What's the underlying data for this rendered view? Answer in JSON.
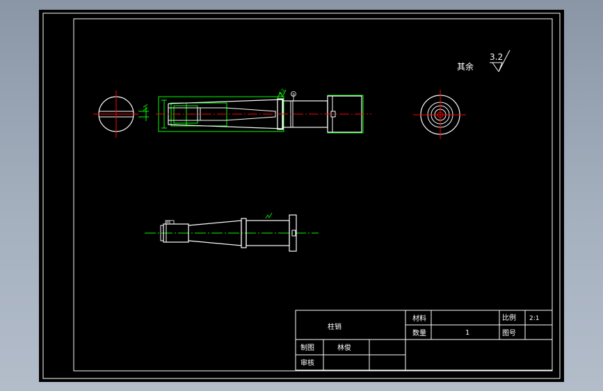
{
  "drawing": {
    "roughness_note": {
      "label": "其余",
      "value": "3.2"
    },
    "datum_marker": "③"
  },
  "title_block": {
    "part_name": "柱销",
    "material_label": "材料",
    "material_value": "",
    "quantity_label": "数量",
    "quantity_value": "1",
    "scale_label": "比例",
    "scale_value": "2:1",
    "drawing_no_label": "图号",
    "drawing_no_value": "",
    "drawn_by_label": "制图",
    "drawn_by_value": "林俊",
    "checked_by_label": "审核",
    "checked_by_value": ""
  },
  "colors": {
    "outline": "#ffffff",
    "dimension": "#00ff00",
    "centerline": "#ff0000",
    "hidden": "#ffff00",
    "background": "#000000"
  }
}
